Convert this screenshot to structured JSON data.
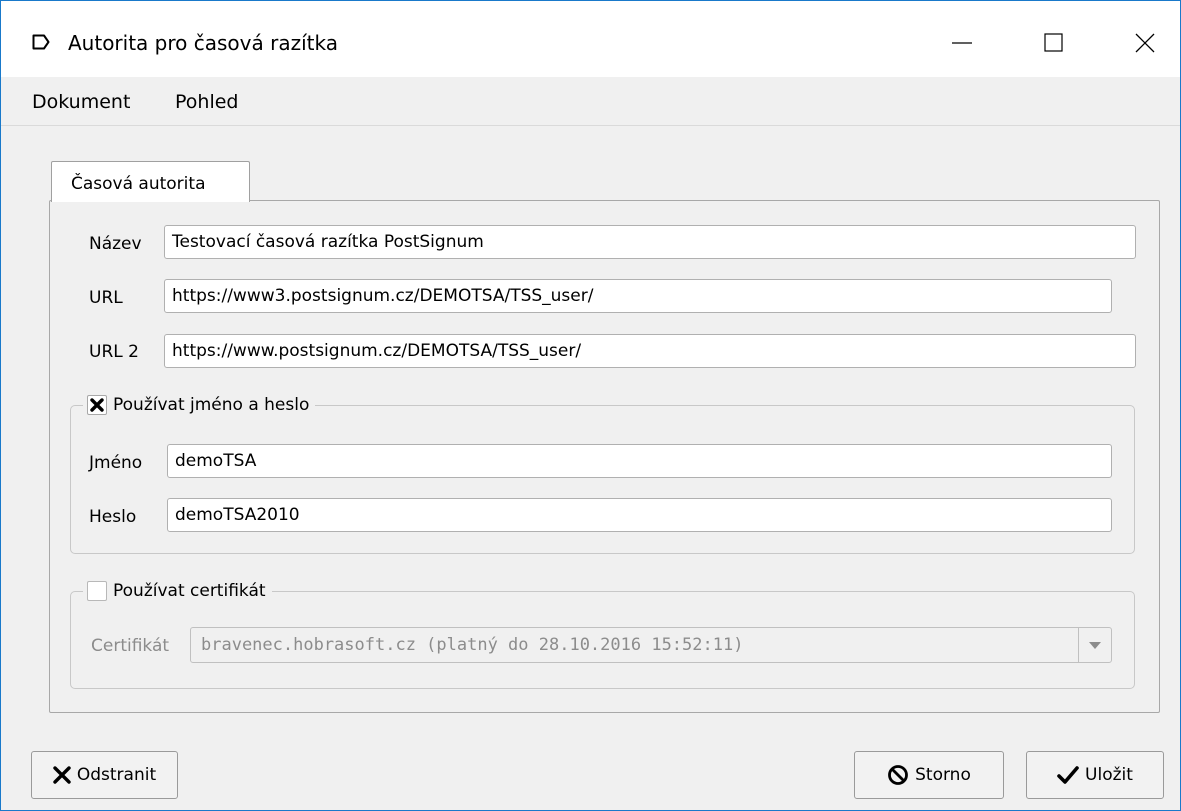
{
  "window": {
    "title": "Autorita pro časová razítka"
  },
  "menu": {
    "items": [
      "Dokument",
      "Pohled"
    ]
  },
  "tab": {
    "label": "Časová autorita"
  },
  "form": {
    "nazev": {
      "label": "Název",
      "value": "Testovací časová razítka PostSignum"
    },
    "url": {
      "label": "URL",
      "value": "https://www3.postsignum.cz/DEMOTSA/TSS_user/"
    },
    "url2": {
      "label": "URL 2",
      "value": "https://www.postsignum.cz/DEMOTSA/TSS_user/"
    }
  },
  "auth_group": {
    "label": "Používat jméno a heslo",
    "checked": true,
    "jmeno": {
      "label": "Jméno",
      "value": "demoTSA"
    },
    "heslo": {
      "label": "Heslo",
      "value": "demoTSA2010"
    }
  },
  "cert_group": {
    "label": "Používat certifikát",
    "checked": false,
    "certifikat": {
      "label": "Certifikát",
      "value": "bravenec.hobrasoft.cz (platný do 28.10.2016 15:52:11)"
    }
  },
  "buttons": {
    "odstranit": "Odstranit",
    "storno": "Storno",
    "ulozit": "Uložit"
  },
  "icons": {
    "app": "window-icon",
    "minimize": "minimize-icon",
    "maximize": "maximize-icon",
    "close": "close-icon",
    "checkbox_checked": "x-mark-icon",
    "dropdown": "dropdown-arrow-icon",
    "odstranit": "x-icon",
    "storno": "prohibited-icon",
    "ulozit": "checkmark-icon"
  },
  "colors": {
    "window_border": "#1979ca",
    "disabled_text": "#8c8c8c"
  }
}
